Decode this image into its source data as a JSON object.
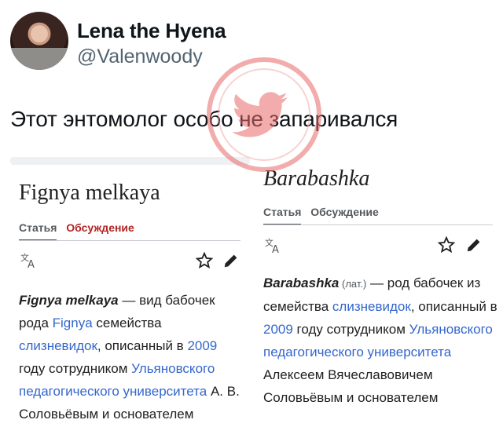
{
  "tweet": {
    "display_name": "Lena the Hyena",
    "handle": "@Valenwoody",
    "text": "Этот энтомолог особо не запаривался"
  },
  "watermark": {
    "icon": "twitter-bird-icon",
    "color": "#e63a3a"
  },
  "wiki_left": {
    "title": "Fignya melkaya",
    "tab_article": "Статья",
    "tab_talk": "Обсуждение",
    "body": {
      "name": "Fignya melkaya",
      "t1": " — вид бабочек рода ",
      "link1": "Fignya",
      "t2": " семейства ",
      "link2": "слизневидок",
      "t3": ", описанный в ",
      "link3": "2009",
      "t4": " году сотрудником ",
      "link4": "Ульяновского педагогического университета",
      "t5": " А. В. Соловьёвым и основателем"
    }
  },
  "wiki_right": {
    "title": "Barabashka",
    "tab_article": "Статья",
    "tab_talk": "Обсуждение",
    "body": {
      "name": "Barabashka",
      "lat": " (лат.)",
      "t1": " — род бабочек из семейства ",
      "link1": "слизневидок",
      "t2": ", описанный в ",
      "link2": "2009",
      "t3": " году сотрудником ",
      "link3": "Ульяновского педагогического университета",
      "t4": " Алексеем Вячеславовичем Соловьёвым и основателем"
    }
  },
  "colors": {
    "link": "#3366cc",
    "talk_red": "#b32424",
    "handle_gray": "#536471"
  }
}
